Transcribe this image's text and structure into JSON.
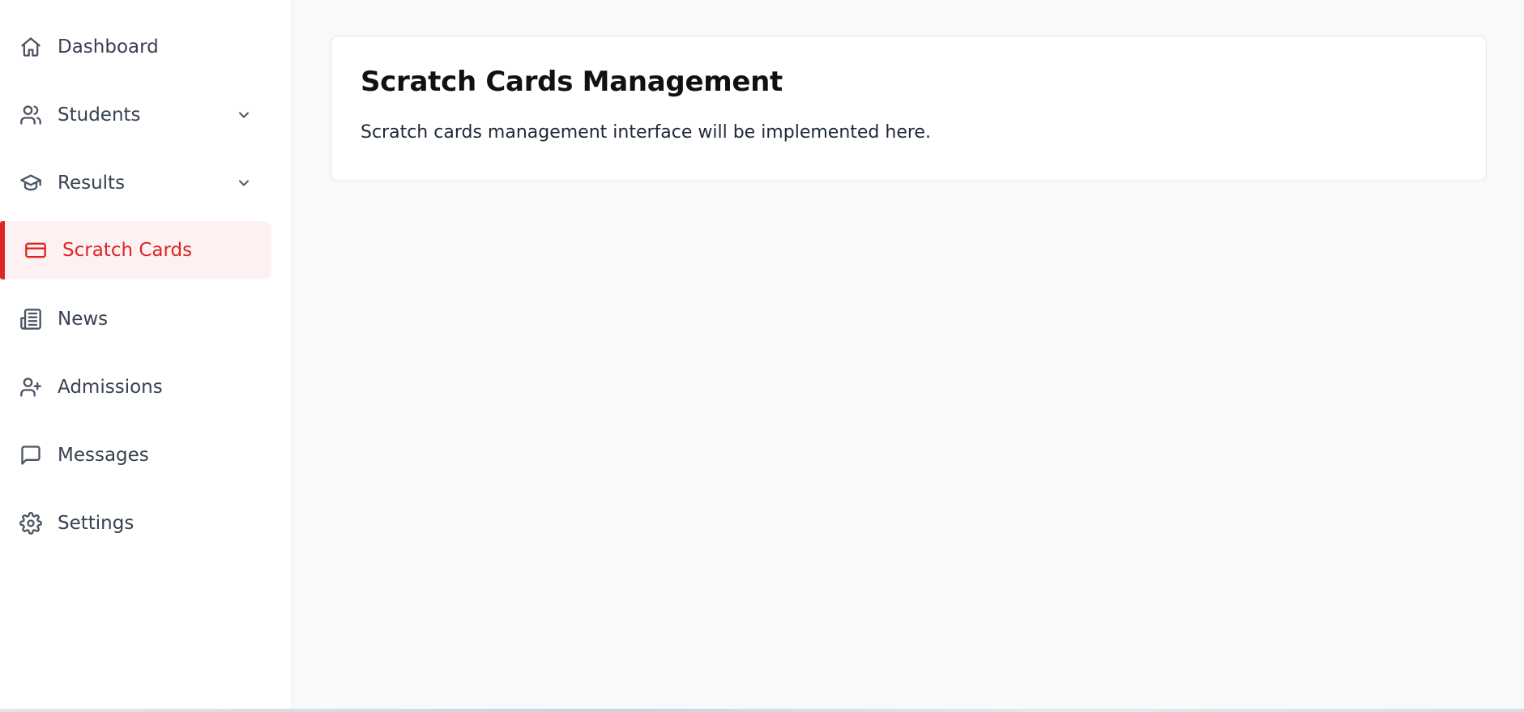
{
  "sidebar": {
    "items": [
      {
        "label": "Dashboard",
        "icon": "home-icon",
        "has_chevron": false,
        "active": false
      },
      {
        "label": "Students",
        "icon": "users-icon",
        "has_chevron": true,
        "active": false
      },
      {
        "label": "Results",
        "icon": "graduation-cap-icon",
        "has_chevron": true,
        "active": false
      },
      {
        "label": "Scratch Cards",
        "icon": "credit-card-icon",
        "has_chevron": false,
        "active": true
      },
      {
        "label": "News",
        "icon": "newspaper-icon",
        "has_chevron": false,
        "active": false
      },
      {
        "label": "Admissions",
        "icon": "user-plus-icon",
        "has_chevron": false,
        "active": false
      },
      {
        "label": "Messages",
        "icon": "message-square-icon",
        "has_chevron": false,
        "active": false
      },
      {
        "label": "Settings",
        "icon": "gear-icon",
        "has_chevron": false,
        "active": false
      }
    ]
  },
  "main": {
    "card": {
      "title": "Scratch Cards Management",
      "text": "Scratch cards management interface will be implemented here."
    }
  },
  "colors": {
    "accent": "#dc2626",
    "active_bg": "#fef1f1",
    "nav_text": "#374151",
    "page_bg": "#f8f9fb"
  }
}
